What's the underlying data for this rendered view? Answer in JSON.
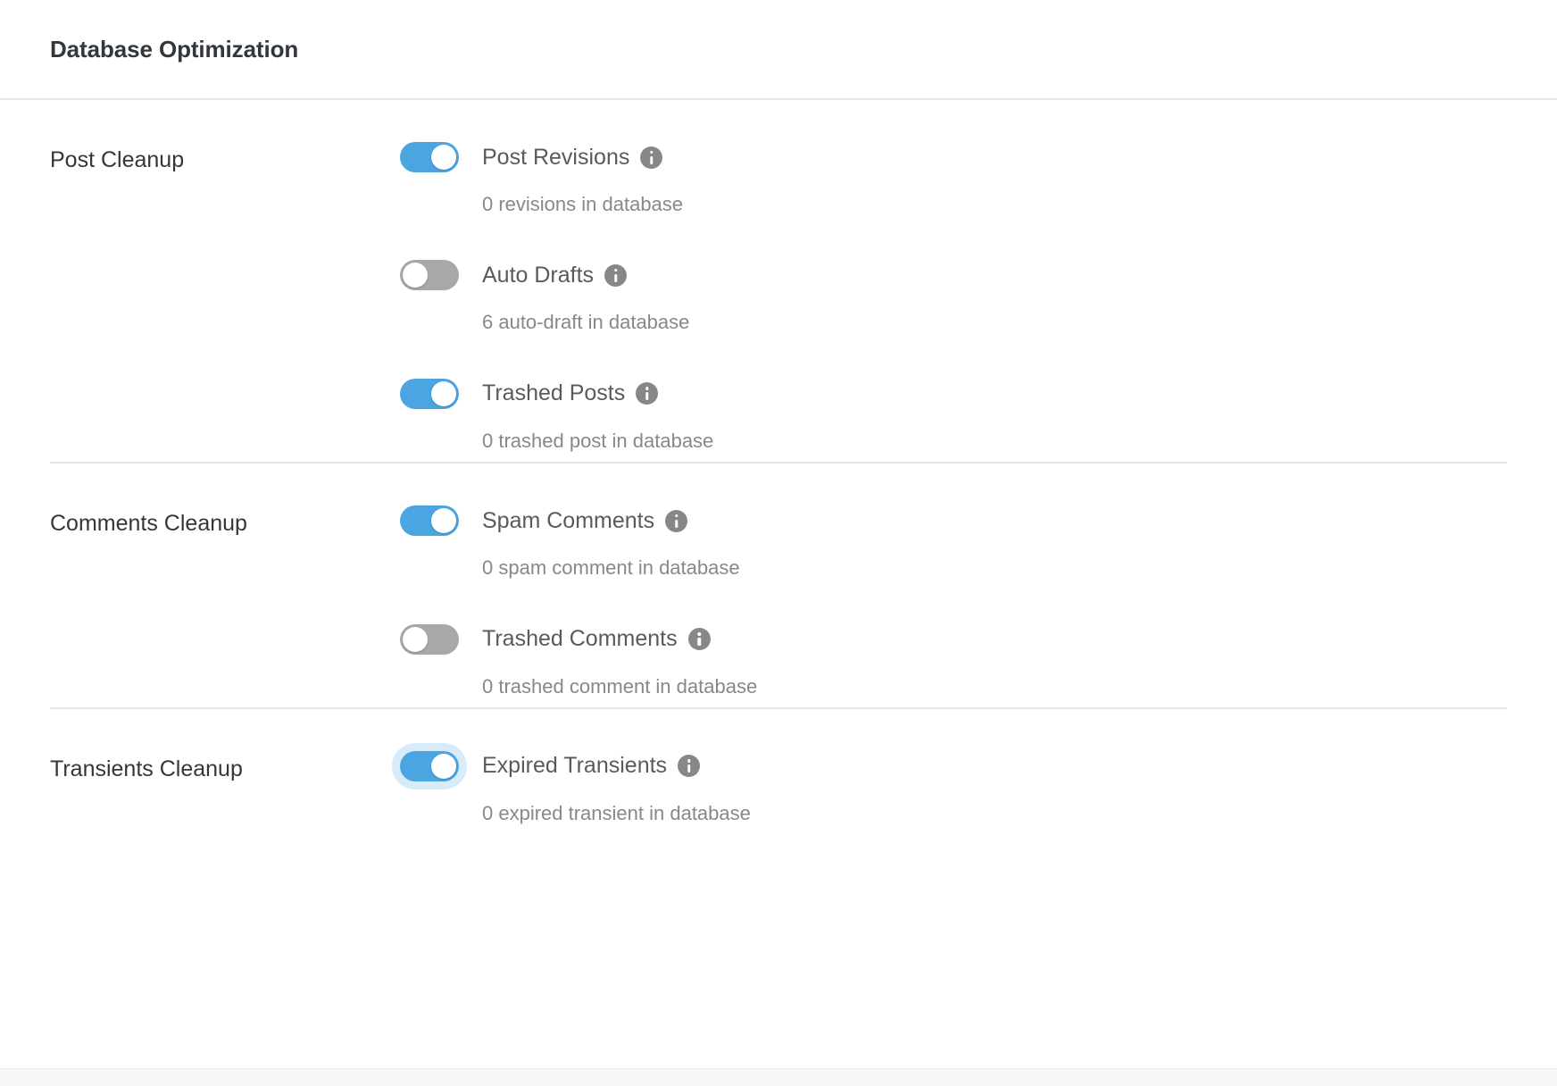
{
  "header": {
    "title": "Database Optimization"
  },
  "colors": {
    "toggle_on": "#4ba5e0",
    "toggle_off": "#a8a8a8",
    "focus_ring": "#d6ecfa",
    "info_icon": "#878787",
    "title_text": "#32373c",
    "label_text": "#5a5a5a",
    "desc_text": "#888888",
    "divider": "#e6e6e6"
  },
  "sections": [
    {
      "label": "Post Cleanup",
      "fields": [
        {
          "label": "Post Revisions",
          "description": "0 revisions in database",
          "state": "on",
          "focused": false,
          "info_icon": "info-icon"
        },
        {
          "label": "Auto Drafts",
          "description": "6 auto-draft in database",
          "state": "off",
          "focused": false,
          "info_icon": "info-icon"
        },
        {
          "label": "Trashed Posts",
          "description": "0 trashed post in database",
          "state": "on",
          "focused": false,
          "info_icon": "info-icon"
        }
      ]
    },
    {
      "label": "Comments Cleanup",
      "fields": [
        {
          "label": "Spam Comments",
          "description": "0 spam comment in database",
          "state": "on",
          "focused": false,
          "info_icon": "info-icon"
        },
        {
          "label": "Trashed Comments",
          "description": "0 trashed comment in database",
          "state": "off",
          "focused": false,
          "info_icon": "info-icon"
        }
      ]
    },
    {
      "label": "Transients Cleanup",
      "fields": [
        {
          "label": "Expired Transients",
          "description": "0 expired transient in database",
          "state": "on",
          "focused": true,
          "info_icon": "info-icon"
        }
      ]
    }
  ]
}
